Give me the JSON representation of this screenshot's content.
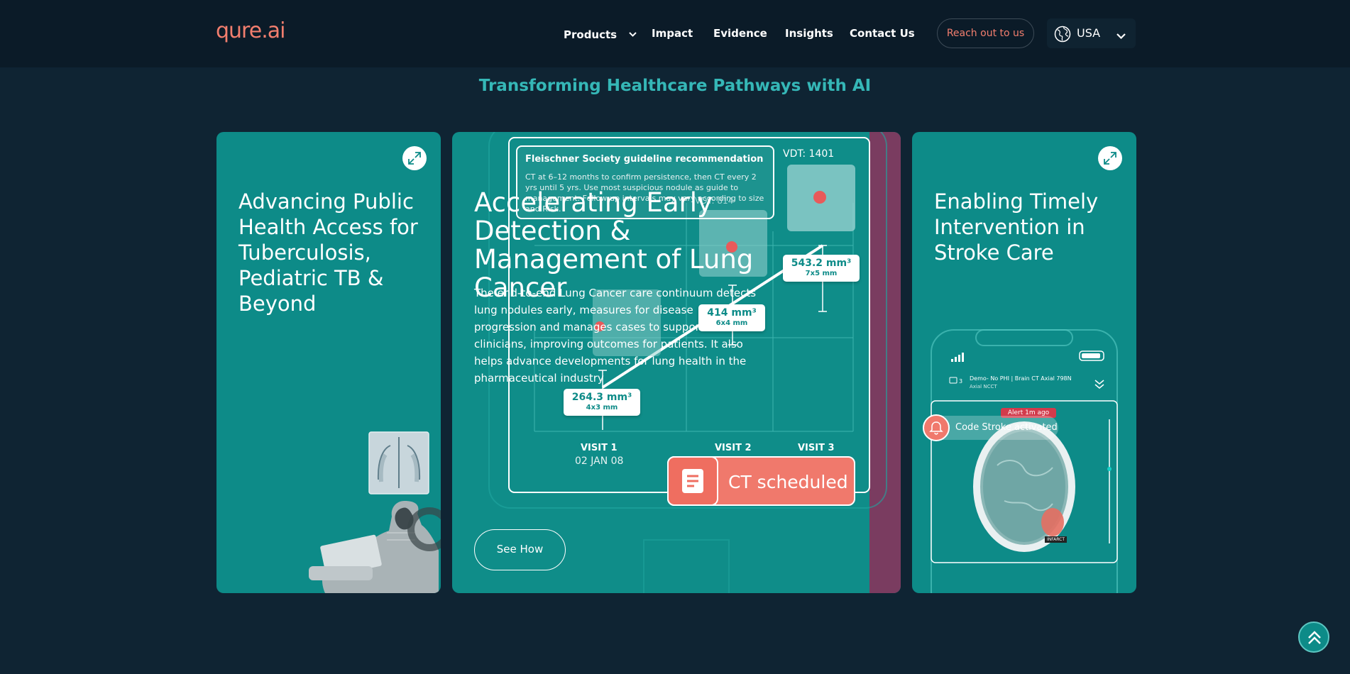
{
  "brand": {
    "logo_text": "qure.ai",
    "accent": "#f27e6e",
    "teal": "#0d8b88"
  },
  "nav": {
    "items": [
      {
        "label": "Products",
        "has_dropdown": true
      },
      {
        "label": "Impact"
      },
      {
        "label": "Evidence"
      },
      {
        "label": "Insights"
      },
      {
        "label": "Contact Us"
      }
    ],
    "cta_label": "Reach out to us",
    "country": {
      "label": "USA",
      "icon": "globe-icon"
    }
  },
  "section": {
    "title": "Transforming Healthcare Pathways with AI"
  },
  "cards": [
    {
      "title": "Advancing Public Health Access for Tuberculosis, Pediatric TB & Beyond",
      "icon": "expand-icon"
    },
    {
      "title": "Accelerating Early Detection & Management of Lung Cancer",
      "description": "The end-to-end Lung Cancer care continuum detects lung nodules early, measures for disease progression and manages cases to support clinicians, improving outcomes for patients. It also helps advance developments for lung health in the pharmaceutical industry",
      "button_label": "See How",
      "illustration": {
        "guideline_title": "Fleischner Society guideline recommendation",
        "guideline_body": "CT at 6–12 months to confirm persistence, then CT every 2 yrs until 5 yrs. Use most suspicious nodule as guide to management. Follow-up intervals may vary according to size and Risk.",
        "vdt_1": "VDT: 1401",
        "vdt_2": "VDT: 814",
        "measurements": [
          {
            "volume": "264.3 mm³",
            "size": "4x3 mm"
          },
          {
            "volume": "414 mm³",
            "size": "6x4 mm"
          },
          {
            "volume": "543.2 mm³",
            "size": "7x5 mm"
          }
        ],
        "visits": [
          {
            "label": "VISIT 1",
            "date": "02 JAN 08"
          },
          {
            "label": "VISIT 2"
          },
          {
            "label": "VISIT 3"
          }
        ],
        "status": "CT scheduled"
      }
    },
    {
      "title": "Enabling Timely Intervention in Stroke Care",
      "icon": "expand-icon",
      "phone": {
        "header": "Demo- No PHI | Brain CT Axial 798N",
        "subheader": "Axial NCCT",
        "count": "3",
        "alert": "Alert 1m ago",
        "banner": "Code Stroke activated",
        "tag": "INFARCT"
      }
    }
  ]
}
